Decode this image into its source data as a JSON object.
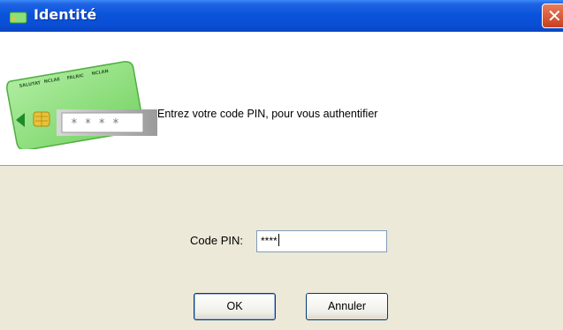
{
  "window": {
    "title": "Identité",
    "close_icon": "close-icon"
  },
  "banner": {
    "message": "Entrez votre code PIN, pour vous authentifier",
    "card_illustration": {
      "header_words": [
        "SALUTAT",
        "NCLAE",
        "FALRIC",
        "NCLAN"
      ],
      "masked_pin": "* * * *",
      "card_color": "#8be07a",
      "chip_color": "#e8c23a"
    }
  },
  "form": {
    "pin_label": "Code PIN:",
    "pin_value": "****"
  },
  "buttons": {
    "ok_label": "OK",
    "cancel_label": "Annuler"
  }
}
